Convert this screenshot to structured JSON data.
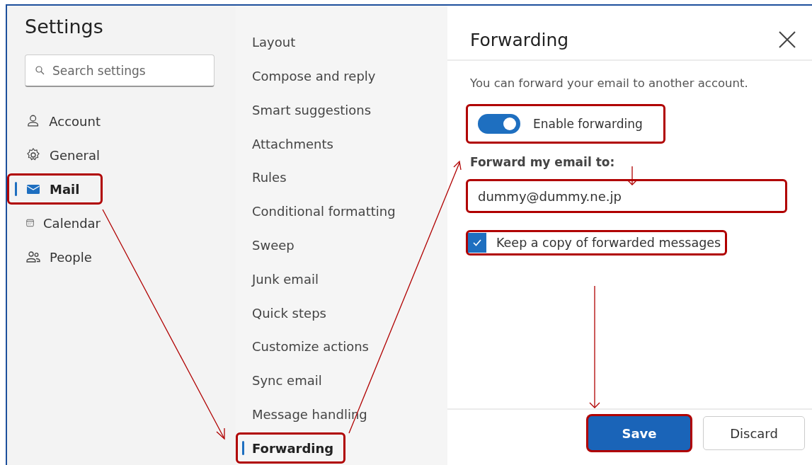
{
  "settings": {
    "title": "Settings",
    "search": {
      "placeholder": "Search settings"
    },
    "nav": [
      {
        "label": "Account",
        "selected": false,
        "highlighted": false
      },
      {
        "label": "General",
        "selected": false,
        "highlighted": false
      },
      {
        "label": "Mail",
        "selected": true,
        "highlighted": true
      },
      {
        "label": "Calendar",
        "selected": false,
        "highlighted": false
      },
      {
        "label": "People",
        "selected": false,
        "highlighted": false
      }
    ]
  },
  "subsections": [
    {
      "label": "Layout",
      "selected": false,
      "highlighted": false
    },
    {
      "label": "Compose and reply",
      "selected": false,
      "highlighted": false
    },
    {
      "label": "Smart suggestions",
      "selected": false,
      "highlighted": false
    },
    {
      "label": "Attachments",
      "selected": false,
      "highlighted": false
    },
    {
      "label": "Rules",
      "selected": false,
      "highlighted": false
    },
    {
      "label": "Conditional formatting",
      "selected": false,
      "highlighted": false
    },
    {
      "label": "Sweep",
      "selected": false,
      "highlighted": false
    },
    {
      "label": "Junk email",
      "selected": false,
      "highlighted": false
    },
    {
      "label": "Quick steps",
      "selected": false,
      "highlighted": false
    },
    {
      "label": "Customize actions",
      "selected": false,
      "highlighted": false
    },
    {
      "label": "Sync email",
      "selected": false,
      "highlighted": false
    },
    {
      "label": "Message handling",
      "selected": false,
      "highlighted": false
    },
    {
      "label": "Forwarding",
      "selected": true,
      "highlighted": true
    }
  ],
  "panel": {
    "title": "Forwarding",
    "description": "You can forward your email to another account.",
    "toggle": {
      "label": "Enable forwarding",
      "on": true,
      "highlighted": true
    },
    "field": {
      "label": "Forward my email to:",
      "value": "dummy@dummy.ne.jp",
      "highlighted": true
    },
    "checkbox": {
      "label": "Keep a copy of forwarded messages",
      "checked": true,
      "highlighted": true
    },
    "buttons": [
      {
        "label": "Save",
        "kind": "primary",
        "highlighted": true
      },
      {
        "label": "Discard",
        "kind": "secondary",
        "highlighted": false
      }
    ]
  }
}
